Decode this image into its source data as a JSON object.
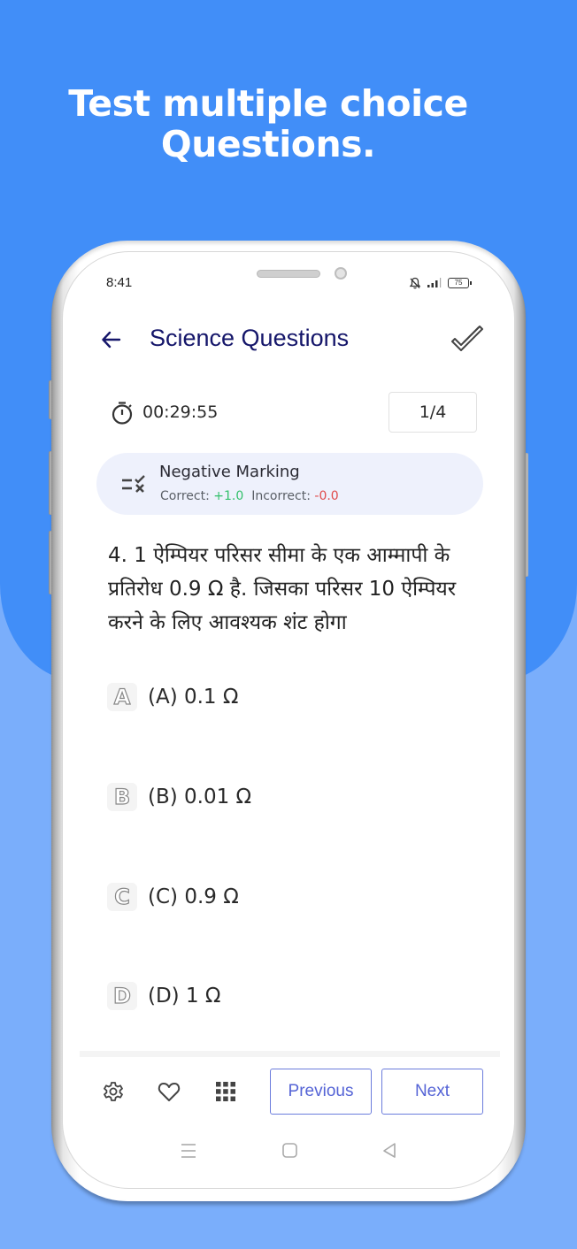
{
  "promo": {
    "headline_line1": "Test multiple choice",
    "headline_line2": "Questions."
  },
  "status_bar": {
    "time": "8:41",
    "icons": [
      "bell-muted-icon",
      "signal-icon",
      "battery-icon"
    ],
    "battery_level": "75"
  },
  "app_bar": {
    "back_icon": "arrow-left-icon",
    "title": "Science Questions",
    "submit_icon": "double-check-icon"
  },
  "quiz_info": {
    "timer_icon": "stopwatch-icon",
    "timer": "00:29:55",
    "counter": "1/4"
  },
  "marking": {
    "icon": "check-cross-list-icon",
    "title": "Negative Marking",
    "correct_label": "Correct:",
    "correct_value": "+1.0",
    "incorrect_label": "Incorrect:",
    "incorrect_value": "-0.0"
  },
  "question": {
    "text": "4. 1 ऐम्पियर परिसर सीमा के एक आम्मापी के प्रतिरोध 0.9 Ω है. जिसका परिसर 10 ऐम्पियर करने के लिए आवश्यक शंट होगा"
  },
  "options": [
    {
      "letter": "A",
      "label": "(A) 0.1 Ω"
    },
    {
      "letter": "B",
      "label": "(B) 0.01 Ω"
    },
    {
      "letter": "C",
      "label": "(C) 0.9 Ω"
    },
    {
      "letter": "D",
      "label": "(D) 1 Ω"
    }
  ],
  "bottom_bar": {
    "icons": [
      "gear-icon",
      "heart-icon",
      "grid-icon"
    ],
    "previous_label": "Previous",
    "next_label": "Next"
  },
  "system_nav": {
    "icons": [
      "menu-icon",
      "home-icon",
      "back-triangle-icon"
    ]
  },
  "colors": {
    "background_top": "#418ef8",
    "background_bottom": "#7aaefb",
    "title": "#15166a",
    "accent": "#5564d6",
    "correct": "#33c06b",
    "incorrect": "#e04b4b",
    "card": "#eef1fc"
  }
}
